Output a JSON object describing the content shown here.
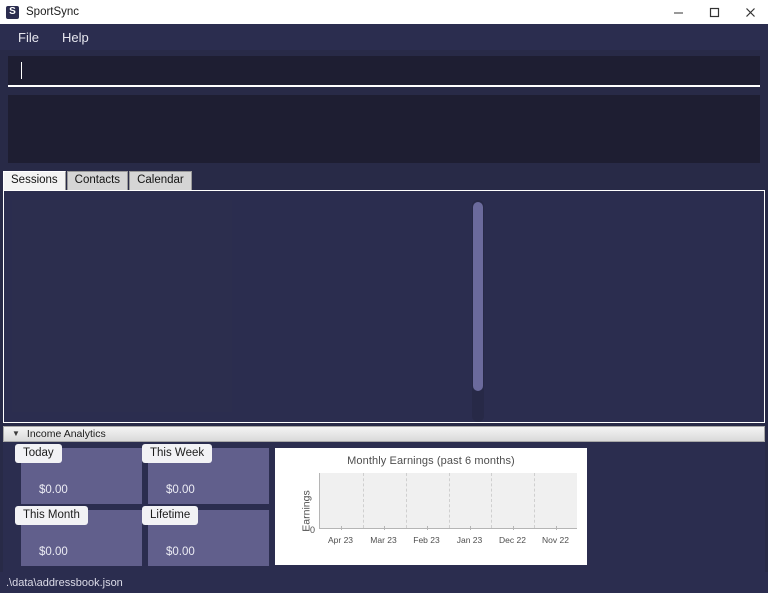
{
  "window": {
    "title": "SportSync",
    "icon": "app-logo-icon",
    "controls": {
      "minimize": "minimize-icon",
      "maximize": "maximize-icon",
      "close": "close-icon"
    }
  },
  "menubar": {
    "items": [
      {
        "label": "File"
      },
      {
        "label": "Help"
      }
    ]
  },
  "command": {
    "value": "",
    "placeholder": "",
    "result": ""
  },
  "tabs": [
    {
      "label": "Sessions",
      "active": true
    },
    {
      "label": "Contacts",
      "active": false
    },
    {
      "label": "Calendar",
      "active": false
    }
  ],
  "analytics": {
    "header": {
      "title": "Income Analytics",
      "toggle_icon": "triangle-down-icon",
      "expanded": true
    },
    "stats": [
      {
        "label": "Today",
        "value": "$0.00"
      },
      {
        "label": "This Week",
        "value": "$0.00"
      },
      {
        "label": "This Month",
        "value": "$0.00"
      },
      {
        "label": "Lifetime",
        "value": "$0.00"
      }
    ]
  },
  "chart_data": {
    "type": "bar",
    "title": "Monthly Earnings (past 6 months)",
    "xlabel": "",
    "ylabel": "Earnings",
    "categories": [
      "Apr 23",
      "Mar 23",
      "Feb 23",
      "Jan 23",
      "Dec 22",
      "Nov 22"
    ],
    "values": [
      0,
      0,
      0,
      0,
      0,
      0
    ],
    "ytick_labels": [
      "0"
    ],
    "ylim": [
      0,
      1
    ],
    "grid": true,
    "legend": false
  },
  "statusbar": {
    "path": ".\\data\\addressbook.json"
  },
  "colors": {
    "window_background": "#282a47",
    "panel_background": "#2b2d4f",
    "input_background": "#1e1e32",
    "card_purple": "#615f8c",
    "scrollbar_thumb": "#6b6a9c",
    "chart_plot_background": "#f0f0f0",
    "titlebar_background": "#ffffff"
  }
}
